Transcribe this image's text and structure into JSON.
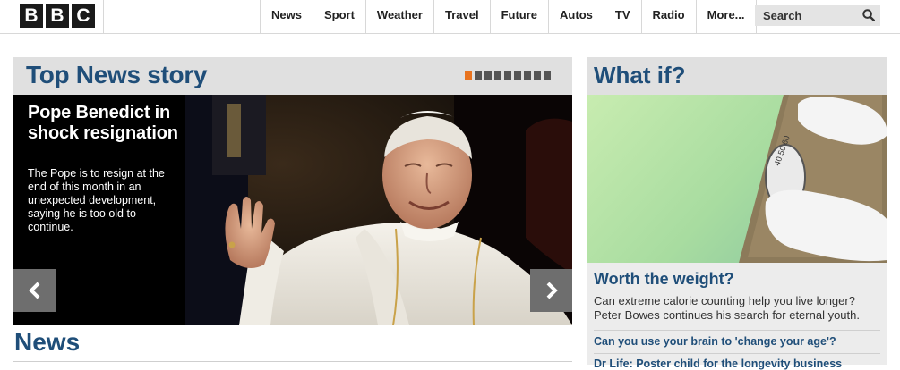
{
  "logo": {
    "letters": [
      "B",
      "B",
      "C"
    ]
  },
  "nav": {
    "items": [
      "News",
      "Sport",
      "Weather",
      "Travel",
      "Future",
      "Autos",
      "TV",
      "Radio",
      "More..."
    ]
  },
  "search": {
    "placeholder": "Search",
    "icon": "search-icon"
  },
  "top_news": {
    "title": "Top News story",
    "carousel": {
      "total": 9,
      "active_index": 0
    },
    "headline": "Pope Benedict in shock resignation",
    "summary": "The Pope is to resign at the end of this month in an unexpected development, saying he is too old to continue.",
    "prev_icon": "chevron-left-icon",
    "next_icon": "chevron-right-icon"
  },
  "news": {
    "heading": "News"
  },
  "what_if": {
    "title": "What if?",
    "story_title": "Worth the weight?",
    "story_summary": "Can extreme calorie counting help you live longer? Peter Bowes continues his search for eternal youth.",
    "links": [
      "Can you use your brain to 'change your age'?",
      "Dr Life: Poster child for the longevity business"
    ]
  },
  "colors": {
    "heading_blue": "#1f4e79",
    "active_dot": "#e8731f",
    "panel_grey": "#e0e0e0"
  }
}
